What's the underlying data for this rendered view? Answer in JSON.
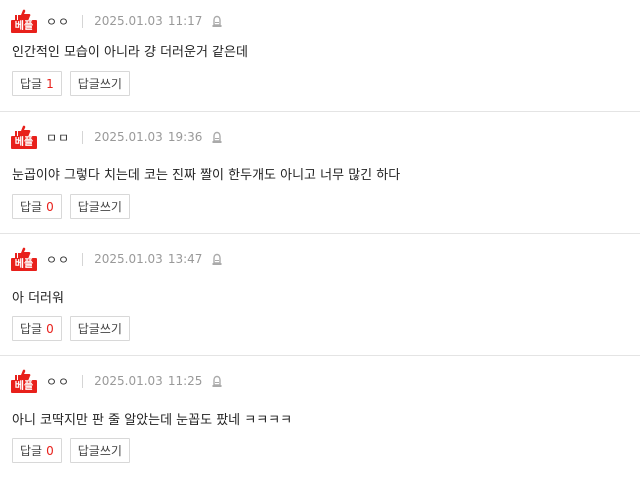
{
  "comments": [
    {
      "badge": "베플",
      "nickname": "ㅇㅇ",
      "date": "2025.01.03",
      "time": "11:17",
      "text": "인간적인 모습이 아니라 걍 더러운거 같은데",
      "reply_label": "답글",
      "reply_count": "1",
      "write_reply_label": "답글쓰기"
    },
    {
      "badge": "베플",
      "nickname": "ㅁㅁ",
      "date": "2025.01.03",
      "time": "19:36",
      "text": "눈곱이야 그렇다 치는데 코는 진짜 짤이 한두개도 아니고 너무 많긴 하다",
      "reply_label": "답글",
      "reply_count": "0",
      "write_reply_label": "답글쓰기"
    },
    {
      "badge": "베플",
      "nickname": "ㅇㅇ",
      "date": "2025.01.03",
      "time": "13:47",
      "text": "아 더러워",
      "reply_label": "답글",
      "reply_count": "0",
      "write_reply_label": "답글쓰기"
    },
    {
      "badge": "베플",
      "nickname": "ㅇㅇ",
      "date": "2025.01.03",
      "time": "11:25",
      "text": "아니 코딱지만 판 줄 알았는데 눈꼽도 팠네 ㅋㅋㅋㅋ",
      "reply_label": "답글",
      "reply_count": "0",
      "write_reply_label": "답글쓰기"
    }
  ],
  "colors": {
    "accent": "#e8201b",
    "meta_text": "#999999",
    "divider": "#e4e4e4"
  },
  "icons": {
    "badge": "thumbs-up-icon",
    "report": "report-bell-icon"
  }
}
